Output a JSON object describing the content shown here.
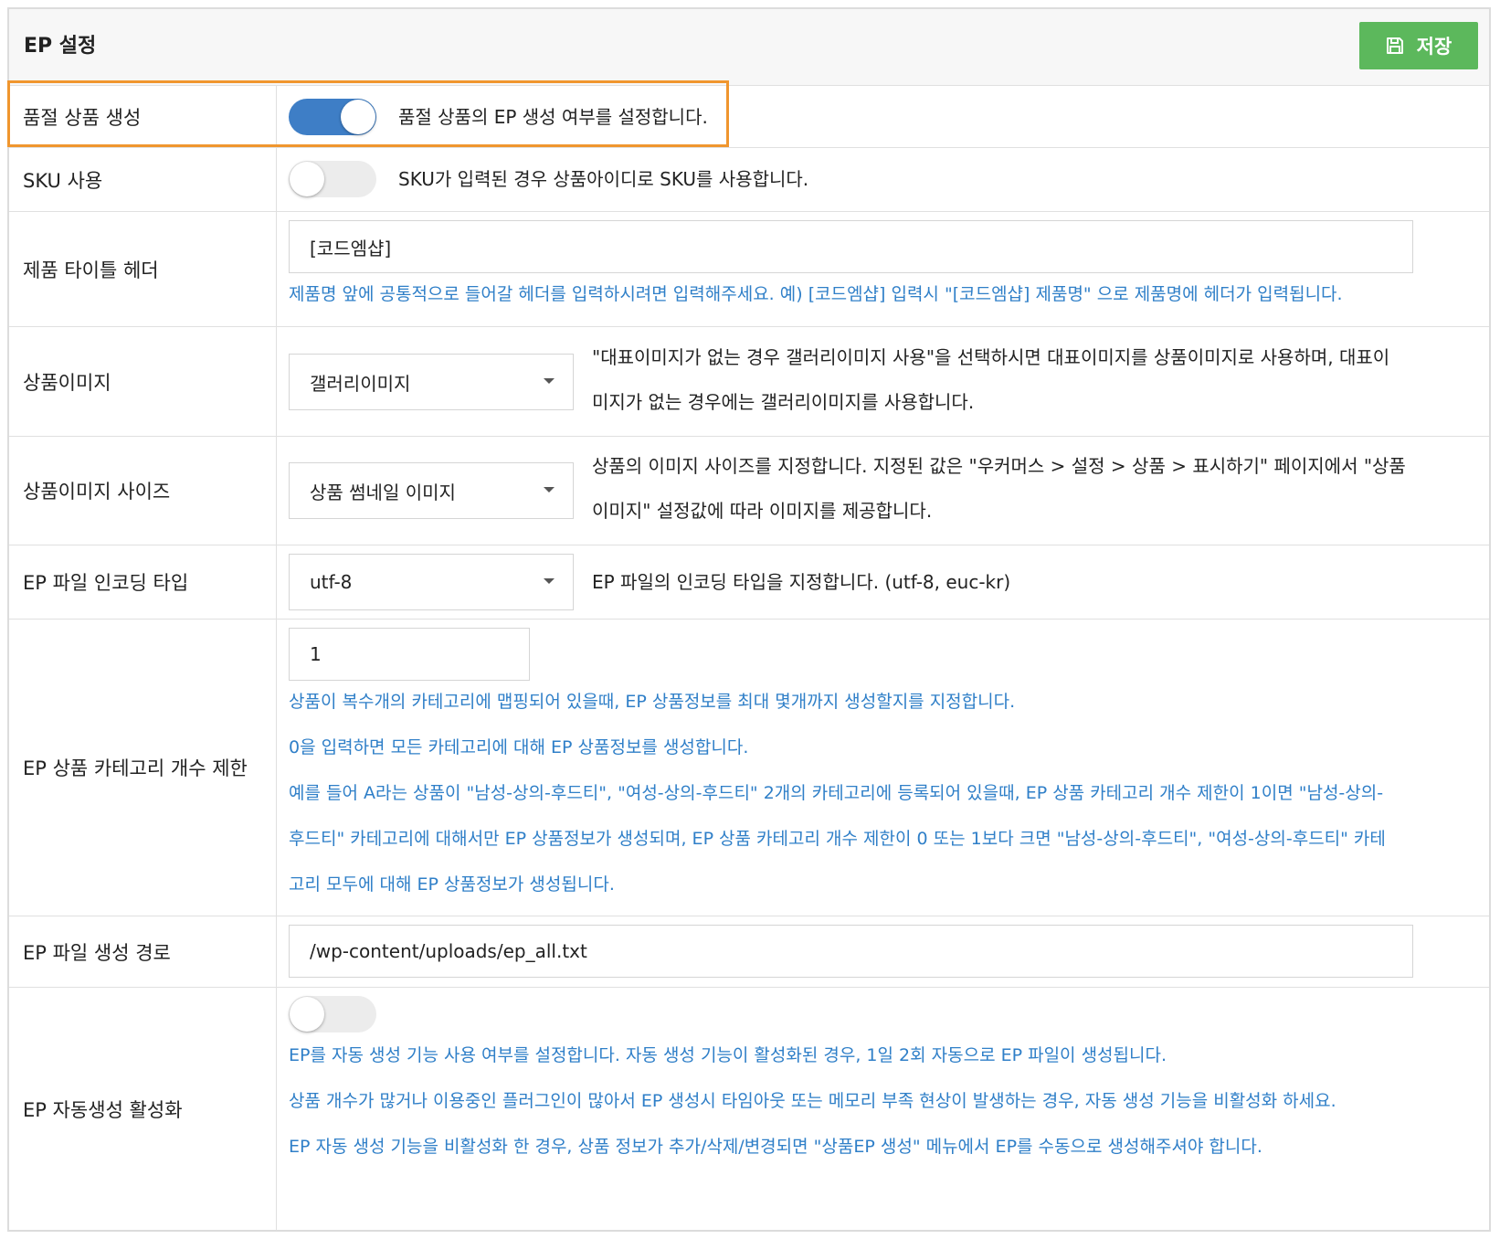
{
  "header": {
    "title": "EP 설정",
    "save_label": "저장",
    "save_icon": "floppy-disk-icon"
  },
  "rows": {
    "soldout": {
      "label": "품절 상품 생성",
      "toggle_on": true,
      "description": "품절 상품의 EP 생성 여부를 설정합니다."
    },
    "sku": {
      "label": "SKU 사용",
      "toggle_on": false,
      "description": "SKU가 입력된 경우 상품아이디로 SKU를 사용합니다."
    },
    "title_header": {
      "label": "제품 타이틀 헤더",
      "value": "[코드엠샵]",
      "help": "제품명 앞에 공통적으로 들어갈 헤더를 입력하시려면 입력해주세요. 예) [코드엠샵] 입력시 \"[코드엠샵] 제품명\" 으로 제품명에 헤더가 입력됩니다."
    },
    "product_image": {
      "label": "상품이미지",
      "selected": "갤러리이미지",
      "description_line1": "\"대표이미지가 없는 경우 갤러리이미지 사용\"을 선택하시면 대표이미지를 상품이미지로 사용하며, 대표이",
      "description_line2": "미지가 없는 경우에는 갤러리이미지를 사용합니다."
    },
    "image_size": {
      "label": "상품이미지 사이즈",
      "selected": "상품 썸네일 이미지",
      "description_line1": "상품의 이미지 사이즈를 지정합니다. 지정된 값은 \"우커머스 > 설정 > 상품 > 표시하기\" 페이지에서 \"상품",
      "description_line2": "이미지\" 설정값에 따라 이미지를 제공합니다."
    },
    "encoding": {
      "label": "EP 파일 인코딩 타입",
      "selected": "utf-8",
      "description": "EP 파일의 인코딩 타입을 지정합니다. (utf-8, euc-kr)"
    },
    "category_limit": {
      "label": "EP 상품 카테고리 개수 제한",
      "value": "1",
      "help_line1": "상품이 복수개의 카테고리에 맵핑되어 있을때, EP 상품정보를 최대 몇개까지 생성할지를 지정합니다.",
      "help_line2": "0을 입력하면 모든 카테고리에 대해 EP 상품정보를 생성합니다.",
      "help_line3": "예를 들어 A라는 상품이 \"남성-상의-후드티\", \"여성-상의-후드티\" 2개의 카테고리에 등록되어 있을때, EP 상품 카테고리 개수 제한이 1이면 \"남성-상의-",
      "help_line4": "후드티\" 카테고리에 대해서만 EP 상품정보가 생성되며, EP 상품 카테고리 개수 제한이 0 또는 1보다 크면 \"남성-상의-후드티\", \"여성-상의-후드티\" 카테",
      "help_line5": "고리 모두에 대해 EP 상품정보가 생성됩니다."
    },
    "file_path": {
      "label": "EP 파일 생성 경로",
      "value": "/wp-content/uploads/ep_all.txt"
    },
    "auto_generate": {
      "label": "EP 자동생성 활성화",
      "toggle_on": false,
      "help_line1": "EP를 자동 생성 기능 사용 여부를 설정합니다. 자동 생성 기능이 활성화된 경우, 1일 2회 자동으로 EP 파일이 생성됩니다.",
      "help_line2": "상품 개수가 많거나 이용중인 플러그인이 많아서 EP 생성시 타임아웃 또는 메모리 부족 현상이 발생하는 경우, 자동 생성 기능을 비활성화 하세요.",
      "help_line3": "EP 자동 생성 기능을 비활성화 한 경우, 상품 정보가 추가/삭제/변경되면 \"상품EP 생성\" 메뉴에서 EP를 수동으로 생성해주셔야 합니다."
    }
  },
  "colors": {
    "save_green": "#5cb85c",
    "toggle_on_blue": "#3e7ec6",
    "help_text_blue": "#2f7fc8",
    "highlight_orange": "#f0962e"
  }
}
